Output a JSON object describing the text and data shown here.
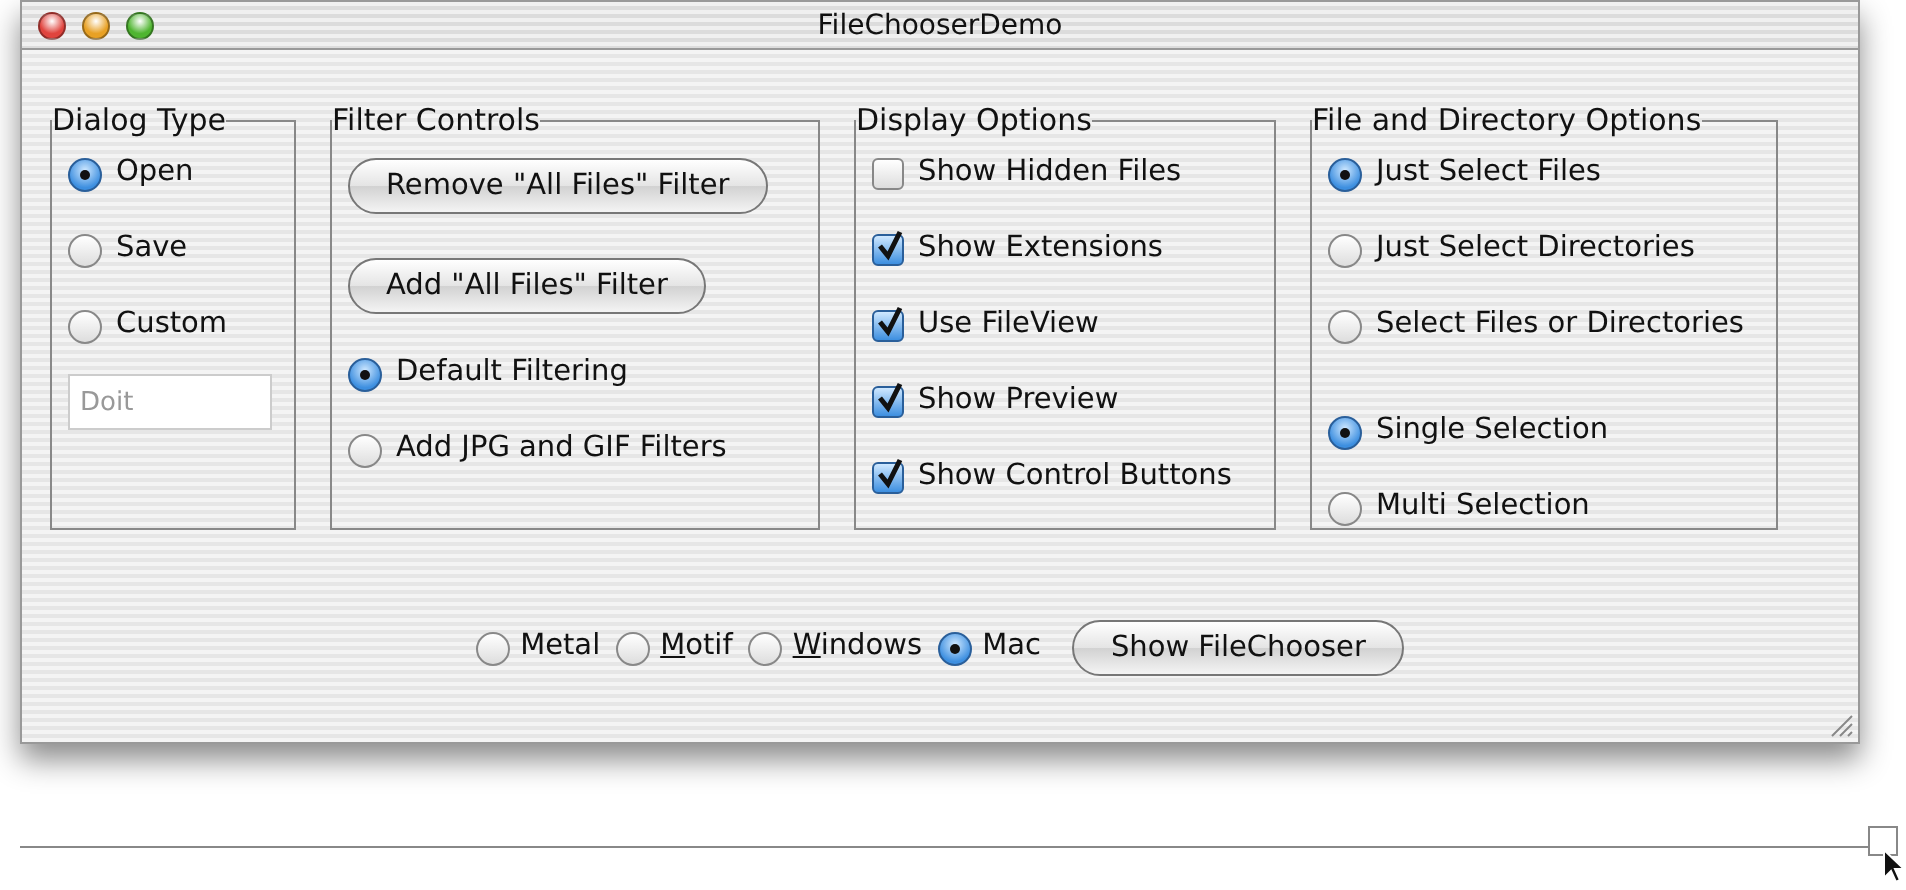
{
  "window": {
    "title": "FileChooserDemo",
    "controls": [
      {
        "color": "#e0443e"
      },
      {
        "color": "#e8a125"
      },
      {
        "color": "#4fb530"
      }
    ]
  },
  "groups": [
    {
      "title": "Dialog Type",
      "sections": [
        {
          "items": [
            {
              "kind": "radio",
              "label": "Open",
              "selected": true
            },
            {
              "kind": "radio",
              "label": "Save",
              "selected": false
            },
            {
              "kind": "radio",
              "label": "Custom",
              "selected": false
            },
            {
              "kind": "field",
              "value": "Doit",
              "disabled": true
            }
          ]
        }
      ]
    },
    {
      "title": "Filter Controls",
      "sections": [
        {
          "items": [
            {
              "kind": "button",
              "label": "Remove \"All Files\" Filter"
            },
            {
              "kind": "button",
              "label": "Add \"All Files\" Filter"
            },
            {
              "kind": "radio",
              "label": "Default Filtering",
              "selected": true
            },
            {
              "kind": "radio",
              "label": "Add JPG and GIF Filters",
              "selected": false
            }
          ]
        }
      ]
    },
    {
      "title": "Display Options",
      "sections": [
        {
          "items": [
            {
              "kind": "checkbox",
              "label": "Show Hidden Files",
              "checked": false
            },
            {
              "kind": "checkbox",
              "label": "Show Extensions",
              "checked": true
            },
            {
              "kind": "checkbox",
              "label": "Use FileView",
              "checked": true
            },
            {
              "kind": "checkbox",
              "label": "Show Preview",
              "checked": true
            },
            {
              "kind": "checkbox",
              "label": "Show Control Buttons",
              "checked": true
            }
          ]
        }
      ]
    },
    {
      "title": "File and Directory Options",
      "sections": [
        {
          "items": [
            {
              "kind": "radio",
              "label": "Just Select Files",
              "selected": true
            },
            {
              "kind": "radio",
              "label": "Just Select Directories",
              "selected": false
            },
            {
              "kind": "radio",
              "label": "Select Files or Directories",
              "selected": false
            }
          ]
        },
        {
          "items": [
            {
              "kind": "radio",
              "label": "Single Selection",
              "selected": true
            },
            {
              "kind": "radio",
              "label": "Multi Selection",
              "selected": false
            }
          ]
        }
      ]
    }
  ],
  "look_and_feel": [
    {
      "label": "Metal",
      "selected": false,
      "mnemonic_underlined": false
    },
    {
      "label": "Motif",
      "selected": false,
      "mnemonic_underlined": true
    },
    {
      "label": "Windows",
      "selected": false,
      "mnemonic_underlined": true
    },
    {
      "label": "Mac",
      "selected": true,
      "mnemonic_underlined": false
    }
  ],
  "show_button": {
    "label": "Show FileChooser"
  }
}
